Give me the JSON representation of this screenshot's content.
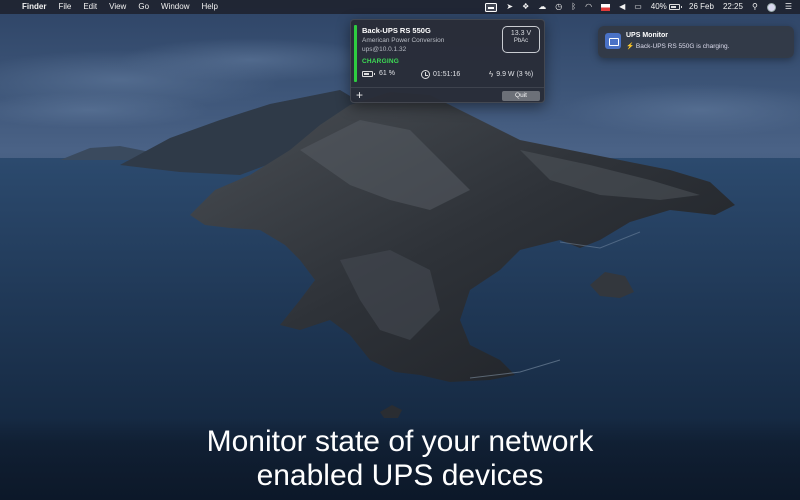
{
  "menubar": {
    "apple": "",
    "app_name": "Finder",
    "menus": [
      "File",
      "Edit",
      "View",
      "Go",
      "Window",
      "Help"
    ],
    "battery_percent": "40%",
    "date": "26 Feb",
    "time": "22:25"
  },
  "popover": {
    "device_name": "Back-UPS RS 550G",
    "vendor": "American Power Conversion",
    "host": "ups@10.0.1.32",
    "state": "CHARGING",
    "voltage": "13.3 V",
    "battery_chemistry": "PbAc",
    "charge": "61 %",
    "runtime": "01:51:16",
    "load": "9.9 W (3 %)",
    "add_label": "+",
    "quit_label": "Quit",
    "charge_level": 0.61,
    "accent_color": "#2ecc40"
  },
  "notification": {
    "app_name": "UPS Monitor",
    "message": "⚡ Back-UPS RS 550G is charging."
  },
  "caption": {
    "line1": "Monitor state of your network",
    "line2": "enabled UPS devices"
  }
}
